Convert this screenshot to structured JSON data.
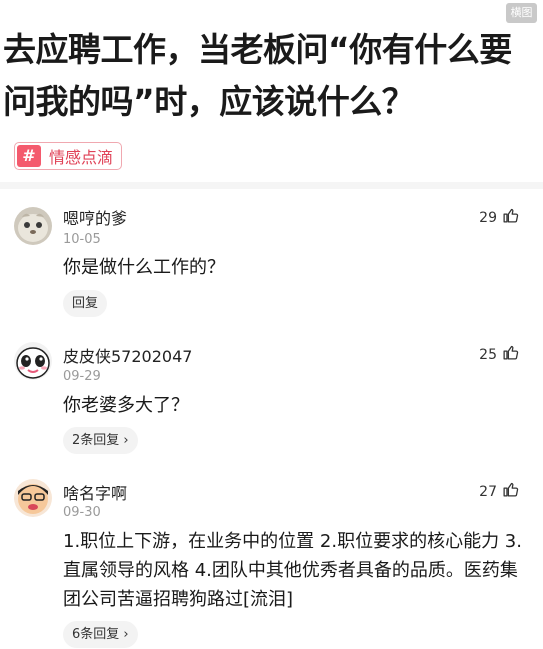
{
  "landscape_badge": "横图",
  "question": {
    "title": "去应聘工作，当老板问“你有什么要问我的吗”时，应该说什么？"
  },
  "topic_tag": {
    "icon": "hash-icon",
    "label": "情感点滴",
    "accent": "#f45a6d"
  },
  "comments": [
    {
      "username": "嗯哼的爹",
      "date": "10-05",
      "likes": "29",
      "text": "你是做什么工作的？",
      "reply": "回复"
    },
    {
      "username": "皮皮侠57202047",
      "date": "09-29",
      "likes": "25",
      "text": "你老婆多大了？",
      "reply": "2条回复 ›"
    },
    {
      "username": "啥名字啊",
      "date": "09-30",
      "likes": "27",
      "text": "1.职位上下游，在业务中的位置 2.职位要求的核心能力 3.直属领导的风格 4.团队中其他优秀者具备的品质。医药集团公司苦逼招聘狗路过[流泪]",
      "reply": "6条回复 ›"
    }
  ]
}
